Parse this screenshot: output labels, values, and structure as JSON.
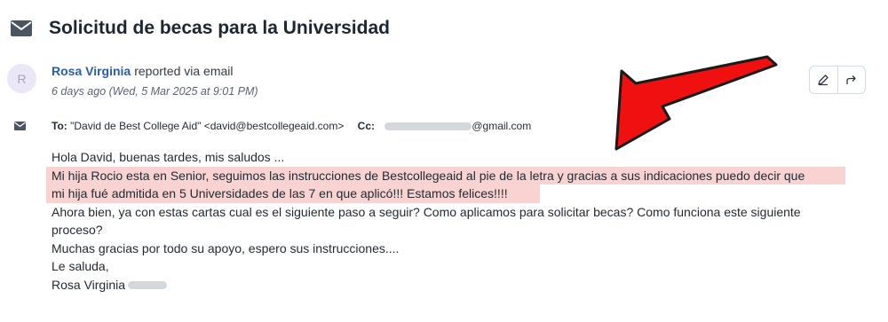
{
  "ticket": {
    "subject": "Solicitud de becas para la Universidad"
  },
  "sender": {
    "avatar_initial": "R",
    "name": "Rosa Virginia",
    "via": "reported via email",
    "timestamp": "6 days ago (Wed, 5 Mar 2025 at 9:01 PM)"
  },
  "recipients": {
    "to_label": "To:",
    "to_value": "\"David de Best College Aid\" <david@bestcollegeaid.com>",
    "cc_label": "Cc:",
    "cc_domain": "@gmail.com"
  },
  "message": {
    "greeting": "Hola David, buenas tardes, mis saludos ...",
    "highlight_line1": "Mi hija Rocio esta en Senior,  seguimos las instrucciones de Bestcollegeaid al pie de la letra y gracias a sus indicaciones puedo  decir que",
    "highlight_line2": "mi hija fué  admitida en 5 Universidades de las 7 en que aplicó!!!  Estamos felices!!!!",
    "question_line1": "Ahora bien, ya con estas cartas cual es el siguiente paso a seguir? Como aplicamos para solicitar becas? Como funciona este siguiente",
    "question_line2": "proceso?",
    "thanks": "Muchas gracias por todo su apoyo, espero sus instrucciones....",
    "closing": "Le saluda,",
    "signature": "Rosa Virginia"
  },
  "icons": {
    "envelope": "envelope-icon",
    "edit": "pencil-icon",
    "forward": "forward-icon",
    "annotation": "red-arrow-icon"
  },
  "colors": {
    "sender_link": "#2a5db0",
    "highlight": "#f9d2d2",
    "arrow": "#f01010"
  }
}
